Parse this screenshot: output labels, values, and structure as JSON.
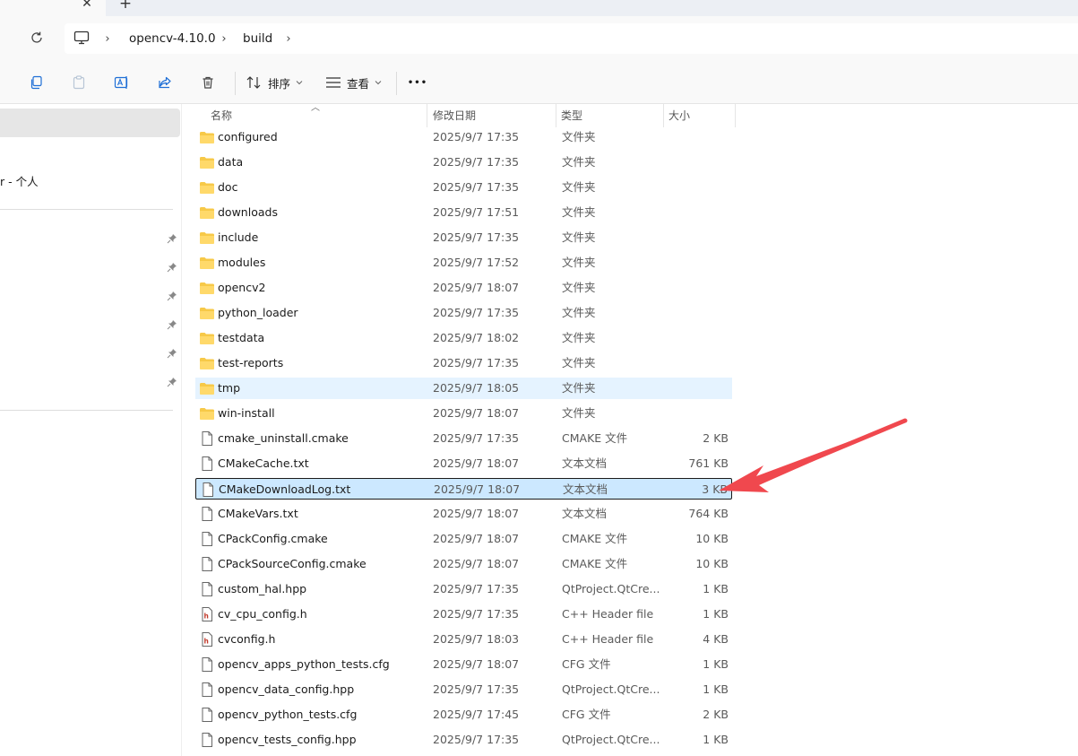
{
  "tabs": {
    "close_glyph": "✕",
    "new_glyph": "+"
  },
  "address": {
    "crumbs": [
      "opencv-4.10.0",
      "build"
    ],
    "separator": "›"
  },
  "toolbar": {
    "sort_label": "排序",
    "view_label": "查看",
    "more_label": "•••"
  },
  "nav": {
    "personal_label": "r - 个人"
  },
  "columns": {
    "name": "名称",
    "modified": "修改日期",
    "type": "类型",
    "size": "大小"
  },
  "files": [
    {
      "name": "configured",
      "date": "2025/9/7 17:35",
      "type": "文件夹",
      "size": "",
      "kind": "folder"
    },
    {
      "name": "data",
      "date": "2025/9/7 17:35",
      "type": "文件夹",
      "size": "",
      "kind": "folder"
    },
    {
      "name": "doc",
      "date": "2025/9/7 17:35",
      "type": "文件夹",
      "size": "",
      "kind": "folder"
    },
    {
      "name": "downloads",
      "date": "2025/9/7 17:51",
      "type": "文件夹",
      "size": "",
      "kind": "folder"
    },
    {
      "name": "include",
      "date": "2025/9/7 17:35",
      "type": "文件夹",
      "size": "",
      "kind": "folder"
    },
    {
      "name": "modules",
      "date": "2025/9/7 17:52",
      "type": "文件夹",
      "size": "",
      "kind": "folder"
    },
    {
      "name": "opencv2",
      "date": "2025/9/7 18:07",
      "type": "文件夹",
      "size": "",
      "kind": "folder"
    },
    {
      "name": "python_loader",
      "date": "2025/9/7 17:35",
      "type": "文件夹",
      "size": "",
      "kind": "folder"
    },
    {
      "name": "testdata",
      "date": "2025/9/7 18:02",
      "type": "文件夹",
      "size": "",
      "kind": "folder"
    },
    {
      "name": "test-reports",
      "date": "2025/9/7 17:35",
      "type": "文件夹",
      "size": "",
      "kind": "folder"
    },
    {
      "name": "tmp",
      "date": "2025/9/7 18:05",
      "type": "文件夹",
      "size": "",
      "kind": "folder"
    },
    {
      "name": "win-install",
      "date": "2025/9/7 18:07",
      "type": "文件夹",
      "size": "",
      "kind": "folder"
    },
    {
      "name": "cmake_uninstall.cmake",
      "date": "2025/9/7 17:35",
      "type": "CMAKE 文件",
      "size": "2 KB",
      "kind": "file"
    },
    {
      "name": "CMakeCache.txt",
      "date": "2025/9/7 18:07",
      "type": "文本文档",
      "size": "761 KB",
      "kind": "file"
    },
    {
      "name": "CMakeDownloadLog.txt",
      "date": "2025/9/7 18:07",
      "type": "文本文档",
      "size": "3 KB",
      "kind": "file"
    },
    {
      "name": "CMakeVars.txt",
      "date": "2025/9/7 18:07",
      "type": "文本文档",
      "size": "764 KB",
      "kind": "file"
    },
    {
      "name": "CPackConfig.cmake",
      "date": "2025/9/7 18:07",
      "type": "CMAKE 文件",
      "size": "10 KB",
      "kind": "file"
    },
    {
      "name": "CPackSourceConfig.cmake",
      "date": "2025/9/7 18:07",
      "type": "CMAKE 文件",
      "size": "10 KB",
      "kind": "file"
    },
    {
      "name": "custom_hal.hpp",
      "date": "2025/9/7 17:35",
      "type": "QtProject.QtCre...",
      "size": "1 KB",
      "kind": "file"
    },
    {
      "name": "cv_cpu_config.h",
      "date": "2025/9/7 17:35",
      "type": "C++ Header file",
      "size": "1 KB",
      "kind": "header"
    },
    {
      "name": "cvconfig.h",
      "date": "2025/9/7 18:03",
      "type": "C++ Header file",
      "size": "4 KB",
      "kind": "header"
    },
    {
      "name": "opencv_apps_python_tests.cfg",
      "date": "2025/9/7 18:07",
      "type": "CFG 文件",
      "size": "1 KB",
      "kind": "file"
    },
    {
      "name": "opencv_data_config.hpp",
      "date": "2025/9/7 17:35",
      "type": "QtProject.QtCre...",
      "size": "1 KB",
      "kind": "file"
    },
    {
      "name": "opencv_python_tests.cfg",
      "date": "2025/9/7 17:45",
      "type": "CFG 文件",
      "size": "2 KB",
      "kind": "file"
    },
    {
      "name": "opencv_tests_config.hpp",
      "date": "2025/9/7 17:35",
      "type": "QtProject.QtCre...",
      "size": "1 KB",
      "kind": "file"
    }
  ],
  "hover_index": 10,
  "selected_index": 14,
  "colors": {
    "folder": "#f7c948",
    "selection": "#cce8ff",
    "hover": "#e5f3ff",
    "annotation_arrow": "#f0484e"
  }
}
